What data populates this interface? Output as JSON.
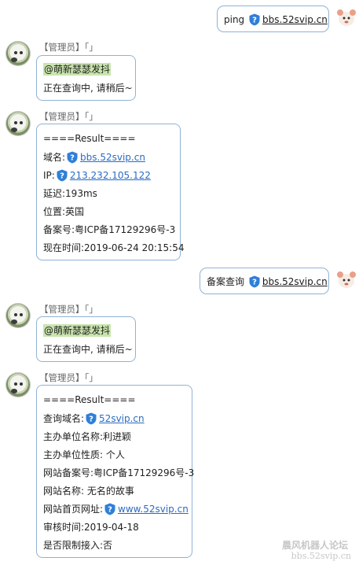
{
  "sender_name": "【管理员】「」",
  "messages": [
    {
      "parts": [
        "ping",
        "bbs.52svip.cn"
      ]
    },
    {
      "mention": "@萌新瑟瑟发抖",
      "text": "正在查询中, 请稍后~"
    },
    {
      "lines": [
        "====Result====",
        "域名:",
        "bbs.52svip.cn",
        "IP:",
        "213.232.105.122",
        "延迟:193ms",
        "位置:英国",
        "备案号:粤ICP备17129296号-3",
        "现在时间:2019-06-24 20:15:54"
      ]
    },
    {
      "parts": [
        "备案查询",
        "bbs.52svip.cn"
      ]
    },
    {
      "mention": "@萌新瑟瑟发抖",
      "text": "正在查询中, 请稍后~"
    },
    {
      "lines": [
        "====Result====",
        "查询域名:",
        "52svip.cn",
        "主办单位名称:利进颖",
        "主办单位性质: 个人",
        "网站备案号:粤ICP备17129296号-3",
        "网站名称: 无名的故事",
        "网站首页网址:",
        "www.52svip.cn",
        "审核时间:2019-04-18",
        "是否限制接入:否"
      ]
    }
  ],
  "watermark": {
    "line1": "晨风机器人论坛",
    "line2": "bbs.52svip.cn"
  },
  "colors": {
    "bubble_border": "#8fb3d4",
    "link": "#2a6bc2",
    "mention_bg": "#c9e5ad",
    "shield": "#2f7fd8"
  }
}
